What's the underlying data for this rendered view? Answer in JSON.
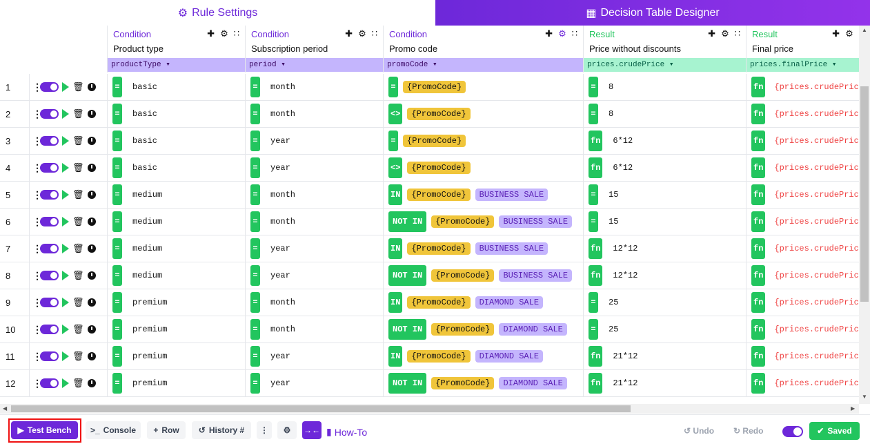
{
  "tabs": {
    "rule_settings": "Rule Settings",
    "decision_table": "Decision Table Designer"
  },
  "columns": [
    {
      "kind": "Condition",
      "title": "Product type",
      "binding": "productType"
    },
    {
      "kind": "Condition",
      "title": "Subscription period",
      "binding": "period"
    },
    {
      "kind": "Condition",
      "title": "Promo code",
      "binding": "promoCode"
    },
    {
      "kind": "Result",
      "title": "Price without discounts",
      "binding": "prices.crudePrice"
    },
    {
      "kind": "Result",
      "title": "Final price",
      "binding": "prices.finalPrice"
    }
  ],
  "rows": [
    {
      "n": "1",
      "product": "basic",
      "period": "month",
      "promo_op": "=",
      "promo": "{PromoCode}",
      "sale": "",
      "price_op": "=",
      "price": "8",
      "final_op": "fn",
      "final": "{prices.crudePrice"
    },
    {
      "n": "2",
      "product": "basic",
      "period": "month",
      "promo_op": "<>",
      "promo": "{PromoCode}",
      "sale": "",
      "price_op": "=",
      "price": "8",
      "final_op": "fn",
      "final": "{prices.crudePrice"
    },
    {
      "n": "3",
      "product": "basic",
      "period": "year",
      "promo_op": "=",
      "promo": "{PromoCode}",
      "sale": "",
      "price_op": "fn",
      "price": "6*12",
      "final_op": "fn",
      "final": "{prices.crudePrice"
    },
    {
      "n": "4",
      "product": "basic",
      "period": "year",
      "promo_op": "<>",
      "promo": "{PromoCode}",
      "sale": "",
      "price_op": "fn",
      "price": "6*12",
      "final_op": "fn",
      "final": "{prices.crudePrice"
    },
    {
      "n": "5",
      "product": "medium",
      "period": "month",
      "promo_op": "IN",
      "promo": "{PromoCode}",
      "sale": "BUSINESS SALE",
      "price_op": "=",
      "price": "15",
      "final_op": "fn",
      "final": "{prices.crudePrice"
    },
    {
      "n": "6",
      "product": "medium",
      "period": "month",
      "promo_op": "NOT IN",
      "promo": "{PromoCode}",
      "sale": "BUSINESS SALE",
      "price_op": "=",
      "price": "15",
      "final_op": "fn",
      "final": "{prices.crudePrice"
    },
    {
      "n": "7",
      "product": "medium",
      "period": "year",
      "promo_op": "IN",
      "promo": "{PromoCode}",
      "sale": "BUSINESS SALE",
      "price_op": "fn",
      "price": "12*12",
      "final_op": "fn",
      "final": "{prices.crudePrice"
    },
    {
      "n": "8",
      "product": "medium",
      "period": "year",
      "promo_op": "NOT IN",
      "promo": "{PromoCode}",
      "sale": "BUSINESS SALE",
      "price_op": "fn",
      "price": "12*12",
      "final_op": "fn",
      "final": "{prices.crudePrice"
    },
    {
      "n": "9",
      "product": "premium",
      "period": "month",
      "promo_op": "IN",
      "promo": "{PromoCode}",
      "sale": "DIAMOND SALE",
      "price_op": "=",
      "price": "25",
      "final_op": "fn",
      "final": "{prices.crudePrice"
    },
    {
      "n": "10",
      "product": "premium",
      "period": "month",
      "promo_op": "NOT IN",
      "promo": "{PromoCode}",
      "sale": "DIAMOND SALE",
      "price_op": "=",
      "price": "25",
      "final_op": "fn",
      "final": "{prices.crudePrice"
    },
    {
      "n": "11",
      "product": "premium",
      "period": "year",
      "promo_op": "IN",
      "promo": "{PromoCode}",
      "sale": "DIAMOND SALE",
      "price_op": "fn",
      "price": "21*12",
      "final_op": "fn",
      "final": "{prices.crudePrice"
    },
    {
      "n": "12",
      "product": "premium",
      "period": "year",
      "promo_op": "NOT IN",
      "promo": "{PromoCode}",
      "sale": "DIAMOND SALE",
      "price_op": "fn",
      "price": "21*12",
      "final_op": "fn",
      "final": "{prices.crudePrice"
    }
  ],
  "toolbar": {
    "test_bench": "Test Bench",
    "console": "Console",
    "row": "Row",
    "history": "History #",
    "how_to": "How-To",
    "undo": "Undo",
    "redo": "Redo",
    "saved": "Saved"
  },
  "colors": {
    "accent": "#6d28d9",
    "success": "#22c55e",
    "chip_yellow": "#f0c53a",
    "chip_purple": "#c4b5fd",
    "fn_text": "#ef4444"
  }
}
